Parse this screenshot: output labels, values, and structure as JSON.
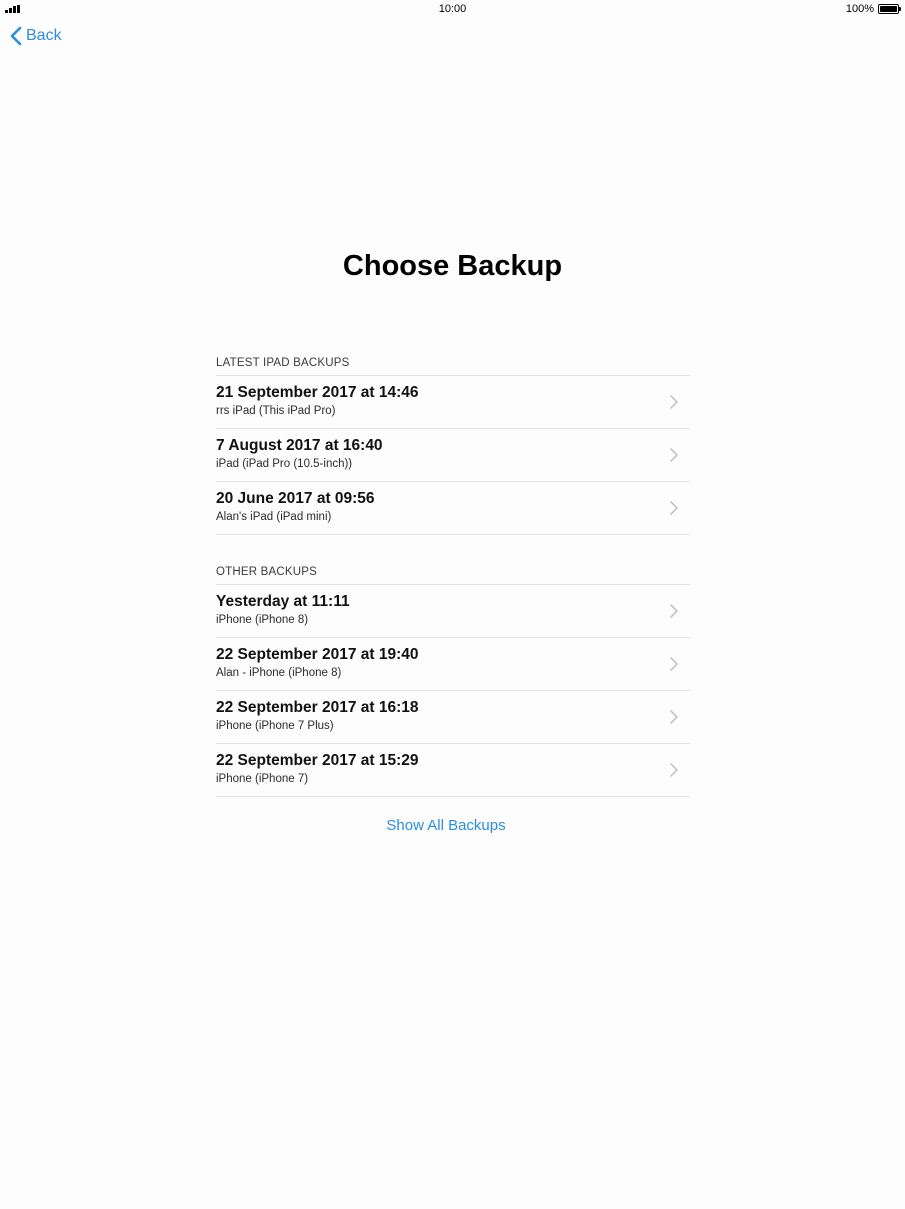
{
  "status_bar": {
    "time": "10:00",
    "battery": "100%",
    "icons": [
      "signal-icon",
      "battery-icon"
    ]
  },
  "nav": {
    "back_label": "Back",
    "back_icon": "chevron-left-icon"
  },
  "title": "Choose Backup",
  "sections": [
    {
      "header": "LATEST IPAD BACKUPS",
      "rows": [
        {
          "title": "21 September 2017 at 14:46",
          "subtitle": "rrs iPad (This iPad Pro)"
        },
        {
          "title": "7 August 2017 at 16:40",
          "subtitle": "iPad (iPad Pro (10.5-inch))"
        },
        {
          "title": "20 June 2017 at 09:56",
          "subtitle": "Alan's iPad (iPad mini)"
        }
      ]
    },
    {
      "header": "OTHER BACKUPS",
      "rows": [
        {
          "title": "Yesterday at 11:11",
          "subtitle": "iPhone (iPhone 8)"
        },
        {
          "title": "22 September 2017 at 19:40",
          "subtitle": "Alan - iPhone (iPhone 8)"
        },
        {
          "title": "22 September 2017 at 16:18",
          "subtitle": "iPhone (iPhone 7 Plus)"
        },
        {
          "title": "22 September 2017 at 15:29",
          "subtitle": "iPhone (iPhone 7)"
        }
      ]
    }
  ],
  "show_all_label": "Show All Backups",
  "colors": {
    "accent": "#2b8ddf",
    "background": "#fdfdfd",
    "separator": "#e4e4e6"
  }
}
